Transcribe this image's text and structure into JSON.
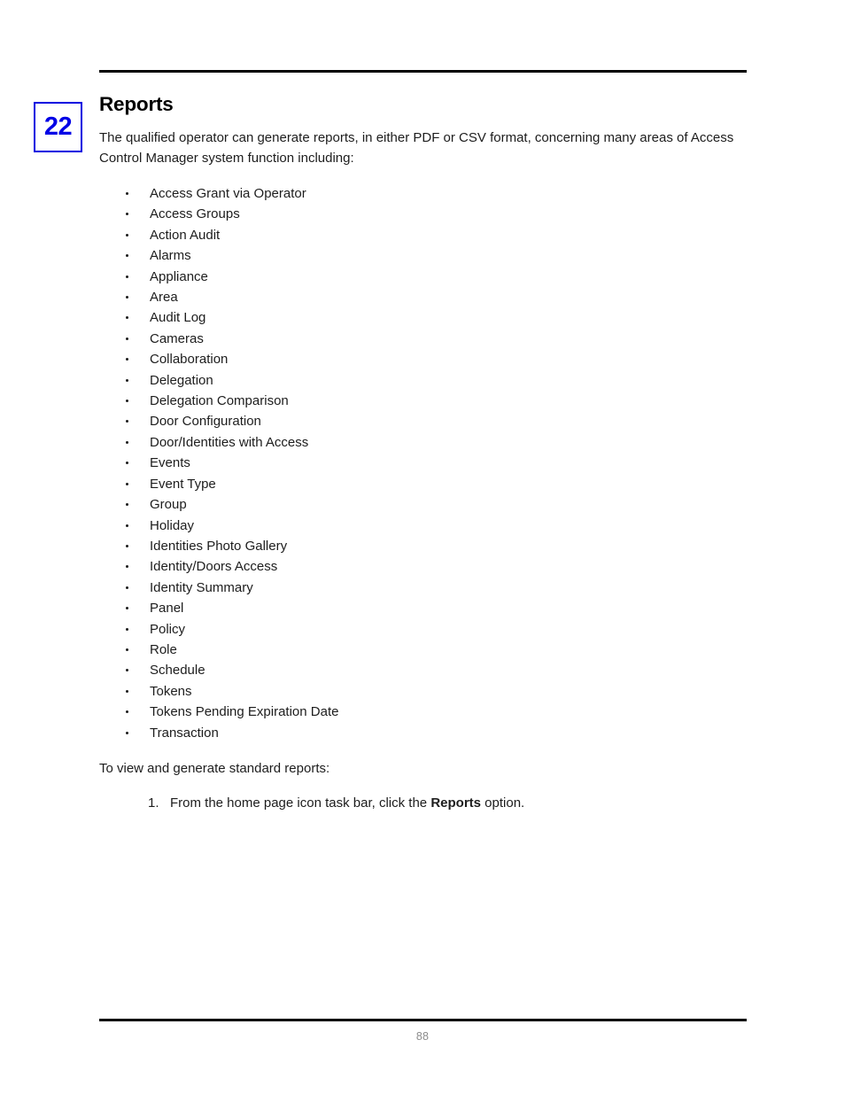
{
  "document": {
    "chapter_number": "22",
    "title": "Reports",
    "intro_paragraph": "The qualified operator can generate reports, in either PDF or CSV format, concerning many areas of Access Control Manager system function including:",
    "report_types": [
      "Access Grant via Operator",
      "Access Groups",
      "Action Audit",
      "Alarms",
      "Appliance",
      "Area",
      "Audit Log",
      "Cameras",
      "Collaboration",
      "Delegation",
      "Delegation Comparison",
      "Door Configuration",
      "Door/Identities with Access",
      "Events",
      "Event Type",
      "Group",
      "Holiday",
      "Identities Photo Gallery",
      "Identity/Doors Access",
      "Identity Summary",
      "Panel",
      "Policy",
      "Role",
      "Schedule",
      "Tokens",
      "Tokens Pending Expiration Date",
      "Transaction"
    ],
    "procedure_intro": "To view and generate standard reports:",
    "steps": [
      {
        "number": "1.",
        "text_before": "From the home page icon task bar, click the ",
        "emphasis": "Reports",
        "text_after": " option."
      }
    ],
    "footer": {
      "page_number": "88"
    },
    "colors": {
      "chapter_accent": "#0000E6",
      "rule": "#000000",
      "body_text": "#1d1d1d",
      "page_number": "#8c8c8c"
    }
  }
}
